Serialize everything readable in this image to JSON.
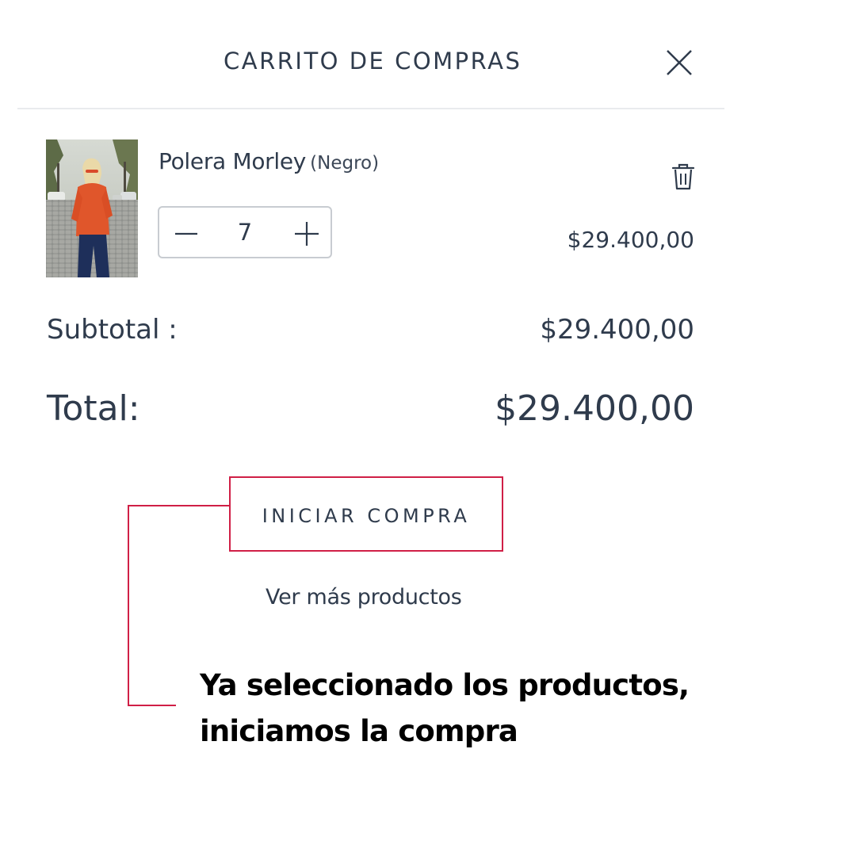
{
  "header": {
    "title": "CARRITO DE COMPRAS",
    "close_icon": "close-icon"
  },
  "cart": {
    "items": [
      {
        "name": "Polera Morley",
        "variant": "(Negro)",
        "quantity": "7",
        "price": "$29.400,00",
        "thumbnail_icon": "product-photo",
        "remove_icon": "trash-icon",
        "minus_icon": "minus-icon",
        "plus_icon": "plus-icon"
      }
    ]
  },
  "summary": {
    "subtotal_label": "Subtotal :",
    "subtotal_value": "$29.400,00",
    "total_label": "Total:",
    "total_value": "$29.400,00"
  },
  "actions": {
    "checkout_label": "INICIAR COMPRA",
    "more_products_label": "Ver más productos"
  },
  "annotation": {
    "line1": "Ya seleccionado los productos,",
    "line2": "iniciamos la compra",
    "highlight_color": "#d01f46"
  },
  "colors": {
    "text": "#2f3b4c",
    "divider": "#e9ebee",
    "stepper_border": "#c8ccd1",
    "accent": "#d01f46"
  }
}
